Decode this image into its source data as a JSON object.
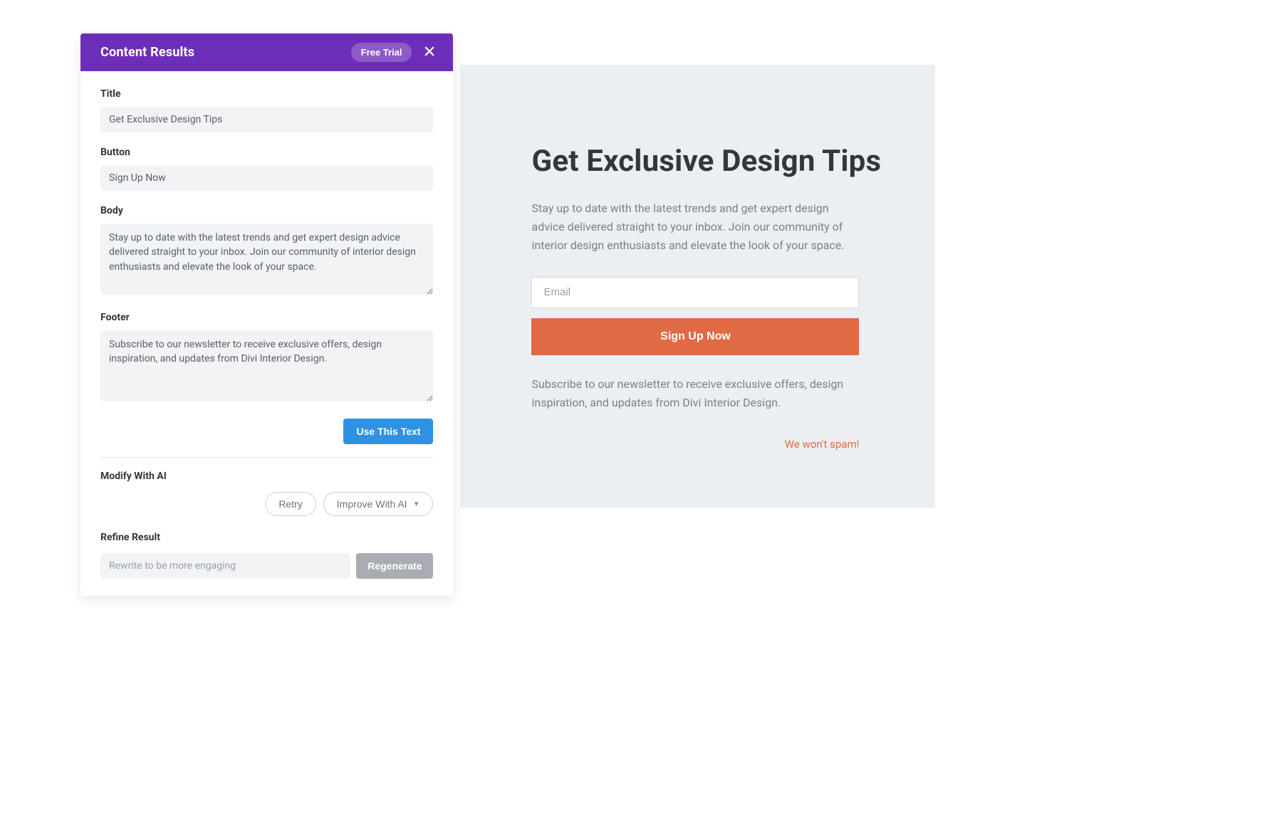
{
  "panel": {
    "header_title": "Content Results",
    "free_trial_label": "Free Trial",
    "fields": {
      "title_label": "Title",
      "title_value": "Get Exclusive Design Tips",
      "button_label": "Button",
      "button_value": "Sign Up Now",
      "body_label": "Body",
      "body_value": "Stay up to date with the latest trends and get expert design advice delivered straight to your inbox. Join our community of interior design enthusiasts and elevate the look of your space.",
      "footer_label": "Footer",
      "footer_value": "Subscribe to our newsletter to receive exclusive offers, design inspiration, and updates from Divi Interior Design."
    },
    "use_text_label": "Use This Text",
    "modify_section_label": "Modify With AI",
    "retry_label": "Retry",
    "improve_label": "Improve With AI",
    "refine_section_label": "Refine Result",
    "refine_placeholder": "Rewrite to be more engaging",
    "regenerate_label": "Regenerate"
  },
  "preview": {
    "heading": "Get Exclusive Design Tips",
    "body": "Stay up to date with the latest trends and get expert design advice delivered straight to your inbox. Join our community of interior design enthusiasts and elevate the look of your space.",
    "email_placeholder": "Email",
    "signup_label": "Sign Up Now",
    "footer": "Subscribe to our newsletter to receive exclusive offers, design inspiration, and updates from Divi Interior Design.",
    "nospam": "We won't spam!"
  }
}
